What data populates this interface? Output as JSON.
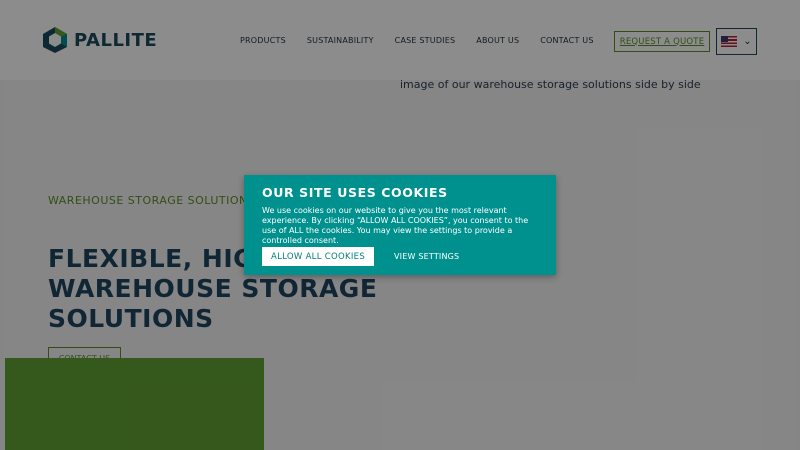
{
  "header": {
    "logo_text": "PALLITE",
    "nav": [
      "PRODUCTS",
      "SUSTAINABILITY",
      "CASE STUDIES",
      "ABOUT US",
      "CONTACT US"
    ],
    "quote_label": "REQUEST A QUOTE",
    "language": "US"
  },
  "hero": {
    "image_alt": "image of our warehouse storage solutions side by side",
    "eyebrow": "WAREHOUSE STORAGE SOLUTIONS",
    "title_lines": [
      "FLEXIBLE, HIGH D",
      "WAREHOUSE STORAGE",
      "SOLUTIONS"
    ],
    "cta_label": "CONTACT US"
  },
  "cookie": {
    "title": "OUR SITE USES COOKIES",
    "text": "We use cookies on our website to give you the most relevant experience. By clicking “ALLOW ALL COOKIES”, you consent to the use of ALL the cookies. You may view the settings to provide a controlled consent.",
    "allow_label": "ALLOW ALL COOKIES",
    "settings_label": "VIEW SETTINGS"
  },
  "colors": {
    "brand_teal": "#00918e",
    "brand_green": "#5a8f2a",
    "navy": "#1f4560"
  }
}
